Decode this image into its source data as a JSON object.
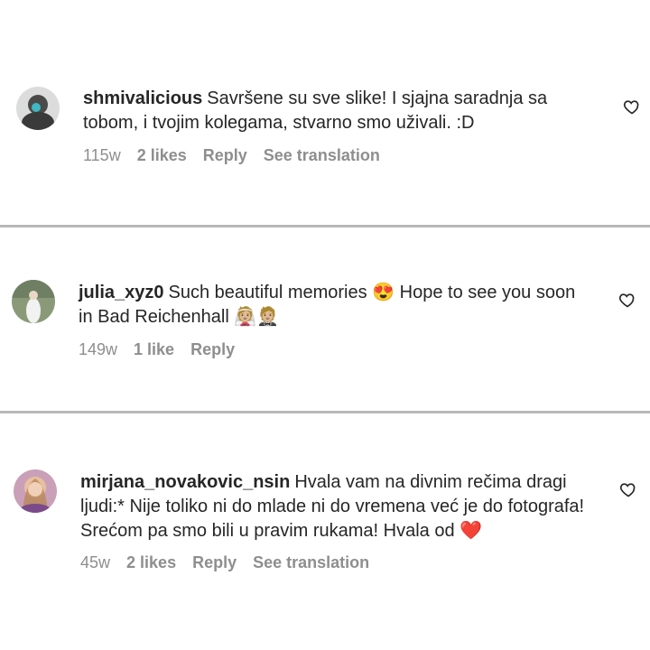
{
  "comments": [
    {
      "username": "shmivalicious",
      "text": "Savršene su sve slike! I sjajna saradnja sa tobom, i tvojim kolegama, stvarno smo uživali. :D",
      "time": "115w",
      "likes": "2 likes",
      "reply": "Reply",
      "translation": "See translation"
    },
    {
      "username": "julia_xyz0",
      "text": "Such beautiful memories 😍 Hope to see you soon in Bad Reichenhall 👰🏼🤵🏼",
      "time": "149w",
      "likes": "1 like",
      "reply": "Reply"
    },
    {
      "username": "mirjana_novakovic_nsin",
      "text": "Hvala vam na divnim rečima dragi ljudi:* Nije toliko ni do mlade ni do vremena već je do fotografa! Srećom pa smo bili u pravim rukama! Hvala od ❤️",
      "time": "45w",
      "likes": "2 likes",
      "reply": "Reply",
      "translation": "See translation"
    }
  ],
  "icons": {
    "like": "heart-outline-icon"
  }
}
